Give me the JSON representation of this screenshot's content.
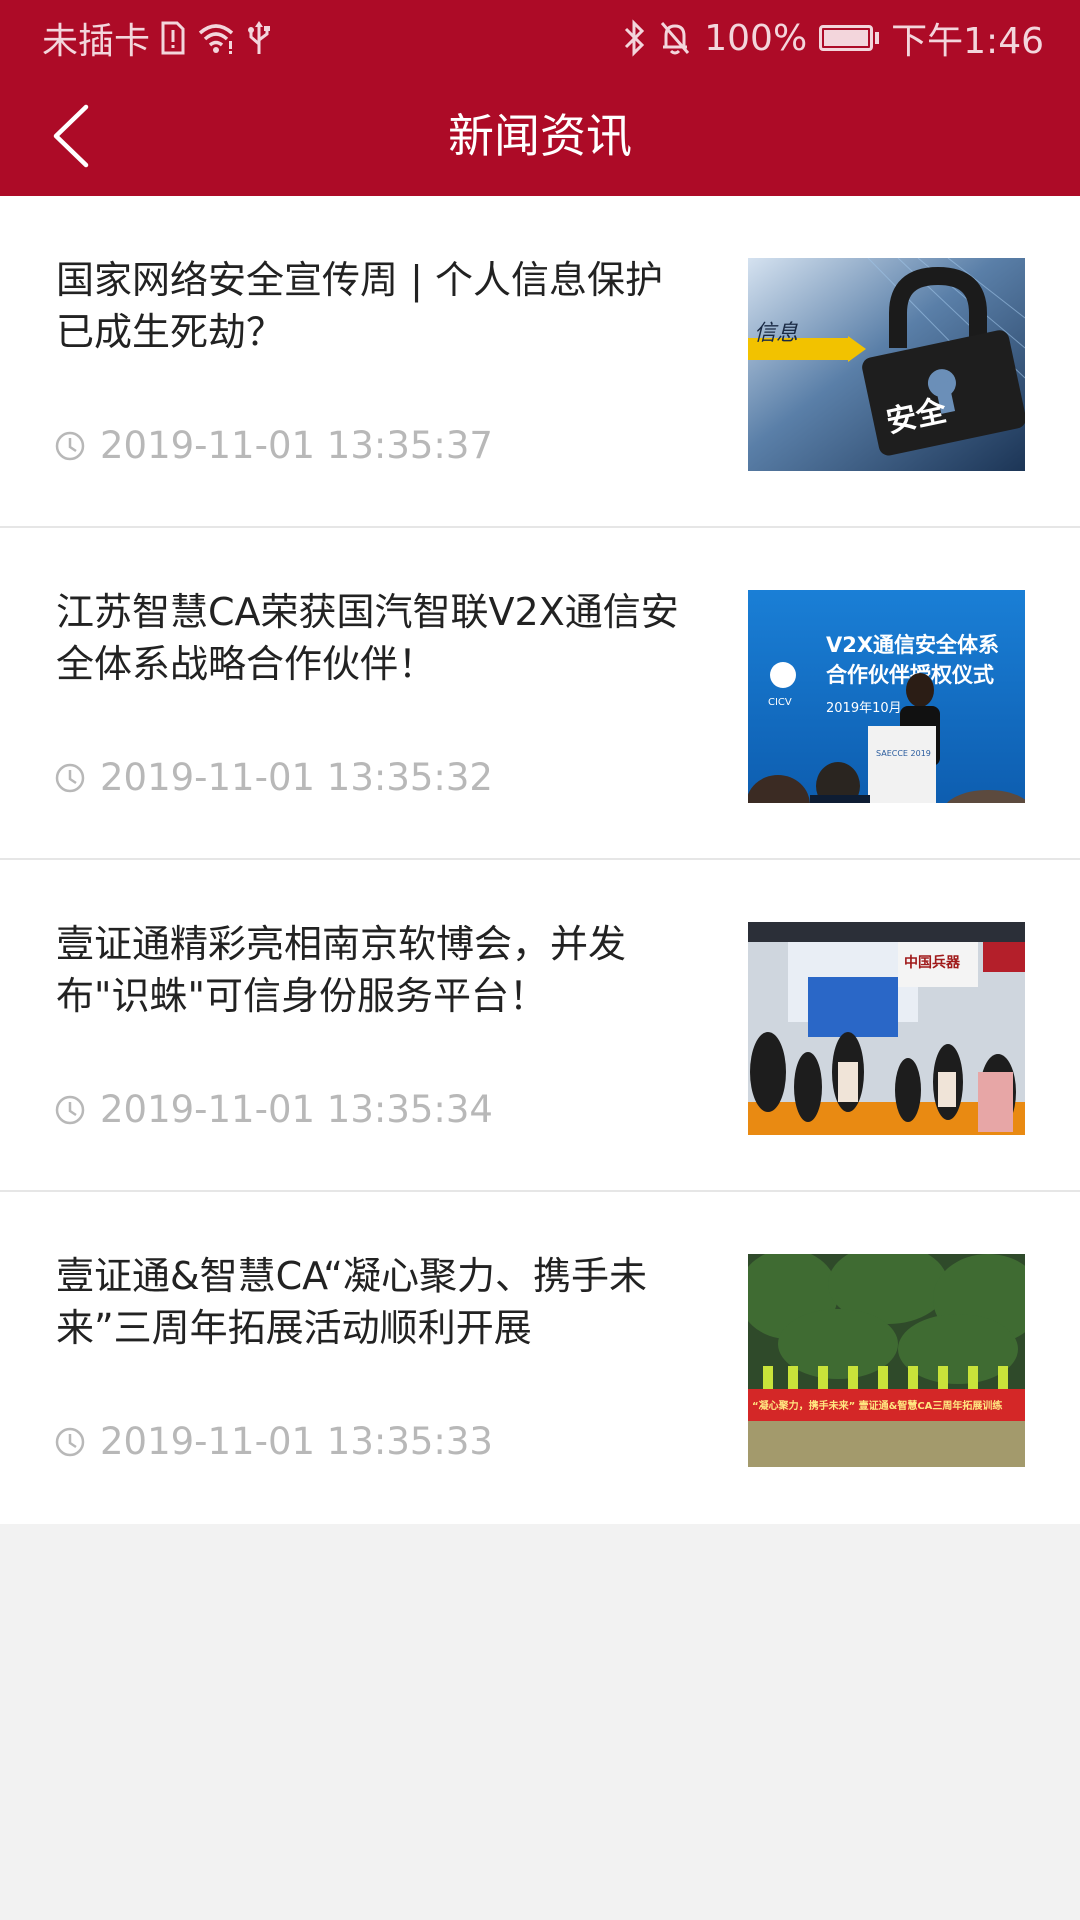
{
  "status_bar": {
    "carrier": "未插卡",
    "battery": "100%",
    "battery_level": 1.0,
    "time": "下午1:46"
  },
  "nav": {
    "title": "新闻资讯",
    "back_icon": "chevron-left-icon"
  },
  "news": [
    {
      "title": "国家网络安全宣传周 | 个人信息保护已成生死劫？",
      "time": "2019-11-01 13:35:37",
      "thumb_caption": "安全",
      "thumb_side_text": "信息"
    },
    {
      "title": "江苏智慧CA荣获国汽智联V2X通信安全体系战略合作伙伴！",
      "time": "2019-11-01 13:35:32",
      "thumb_caption": "V2X通信安全体系",
      "thumb_caption2": "合作伙伴授权仪式",
      "thumb_logo": "CICV",
      "thumb_date": "2019年10月",
      "thumb_podium": "SAECCE 2019"
    },
    {
      "title": "壹证通精彩亮相南京软博会，并发布\"识蛛\"可信身份服务平台！",
      "time": "2019-11-01 13:35:34",
      "thumb_sign": "中国兵器"
    },
    {
      "title": "壹证通&智慧CA“凝心聚力、携手未来”三周年拓展活动顺利开展",
      "time": "2019-11-01 13:35:33",
      "thumb_banner": "“凝心聚力，携手未来” 壹证通&智慧CA三周年拓展训练"
    }
  ],
  "colors": {
    "header_bg": "#ad0b27",
    "page_bg": "#f2f2f2",
    "title_text": "#222222",
    "time_text": "#b8b8b8"
  }
}
